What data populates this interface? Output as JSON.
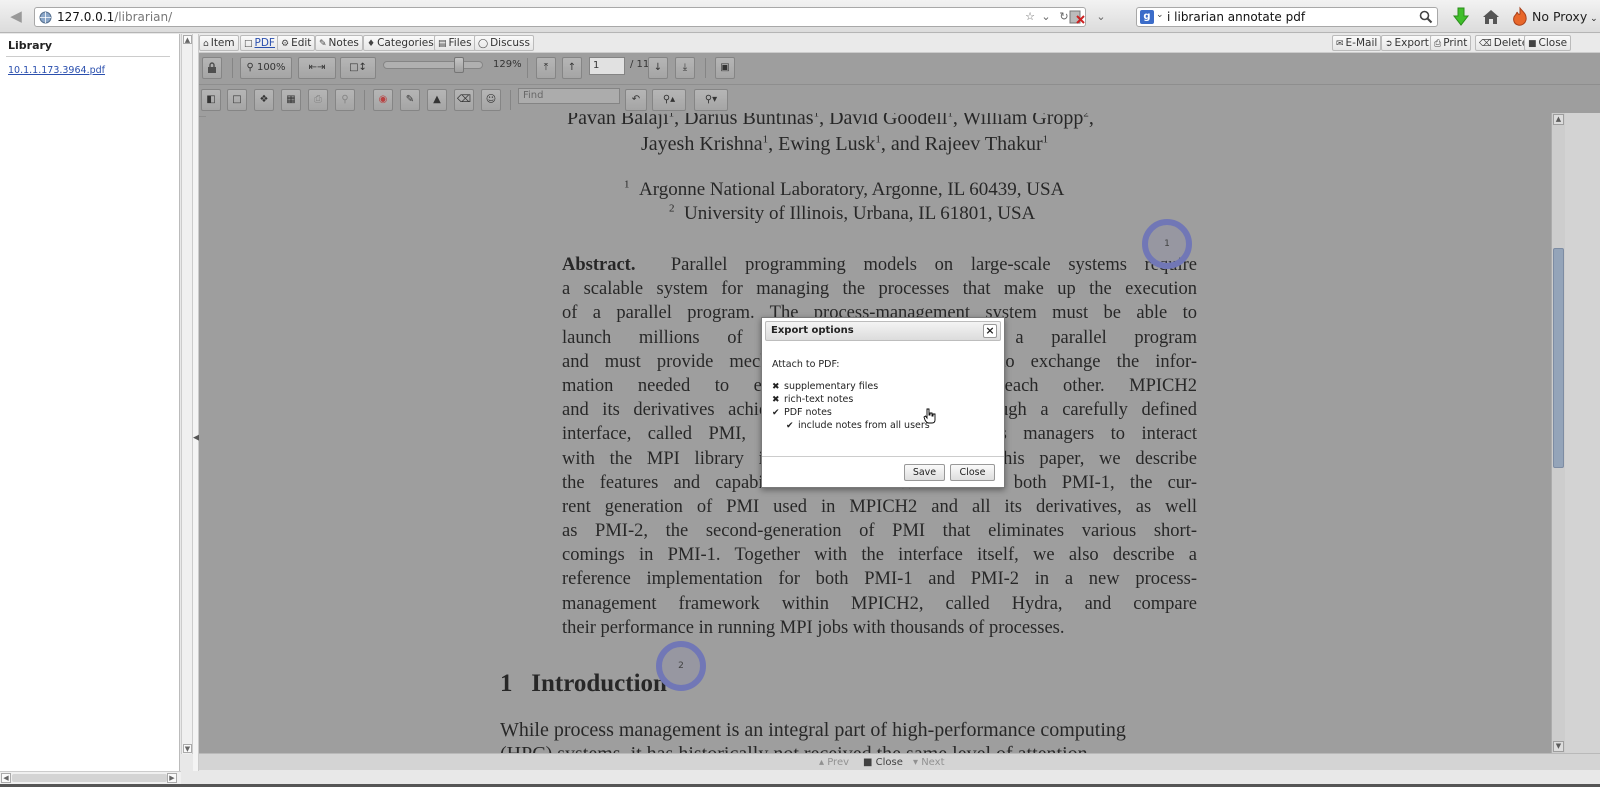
{
  "browser": {
    "url_host": "127.0.0.1",
    "url_path": "/librarian/",
    "search_query": "i librarian annotate pdf",
    "proxy_label": "No Proxy"
  },
  "sidebar": {
    "title": "Library",
    "files": [
      "10.1.1.173.3964.pdf"
    ]
  },
  "tabs_left": [
    {
      "label": "Item",
      "icon": "home-icon"
    },
    {
      "label": "PDF",
      "icon": "document-icon",
      "active": true
    },
    {
      "label": "Edit",
      "icon": "gear-icon"
    },
    {
      "label": "Notes",
      "icon": "pencil-icon"
    },
    {
      "label": "Categories",
      "icon": "tag-icon"
    },
    {
      "label": "Files",
      "icon": "files-icon"
    },
    {
      "label": "Discuss",
      "icon": "chat-icon"
    }
  ],
  "tabs_right": [
    {
      "label": "E-Mail",
      "icon": "mail-icon"
    },
    {
      "label": "Export",
      "icon": "export-icon"
    },
    {
      "label": "Print",
      "icon": "print-icon"
    },
    {
      "label": "Delete",
      "icon": "trash-icon"
    },
    {
      "label": "Close",
      "icon": "close-icon"
    }
  ],
  "viewer": {
    "zoom_button": "100%",
    "zoom_value": "129%",
    "current_page": "1",
    "total_pages": "/ 11",
    "find_placeholder": "Find",
    "slider_level": 0.8
  },
  "document": {
    "authors_line1": [
      "Pavan Balaji",
      "1",
      ", Darius Buntinas",
      "1",
      ", David Goodell",
      "1",
      ", William Gropp",
      "2",
      ","
    ],
    "authors_line2": [
      "Jayesh Krishna",
      "1",
      ", Ewing Lusk",
      "1",
      ", and Rajeev Thakur",
      "1"
    ],
    "affiliation1": {
      "sup": "1",
      "text": "Argonne National Laboratory, Argonne, IL 60439, USA"
    },
    "affiliation2": {
      "sup": "2",
      "text": "University of Illinois, Urbana, IL 61801, USA"
    },
    "abstract_label": "Abstract.",
    "abstract_lines": [
      "Parallel programming models on large-scale systems require",
      "a scalable system for managing the processes that make up the execution",
      "of a parallel program. The process-management system must be able to",
      "launch millions of processes and initialize a parallel program",
      "and must provide mechanisms for the processes to exchange the infor-",
      "mation needed to enable them to contact each other. MPICH2",
      "and its derivatives achieve these functionalities through a carefully defined",
      "interface, called PMI, that allows different process managers to interact",
      "with the MPI library in a standardized way. In this paper, we describe",
      "the features and capabilities of PMI. We describe both PMI-1, the cur-",
      "rent generation of PMI used in MPICH2 and all its derivatives, as well",
      "as PMI-2, the second-generation of PMI that eliminates various short-",
      "comings in PMI-1. Together with the interface itself, we also describe a",
      "reference implementation for both PMI-1 and PMI-2 in a new process-",
      "management framework within MPICH2, called Hydra, and compare",
      "their performance in running MPI jobs with thousands of processes."
    ],
    "section_number": "1",
    "section_title": "Introduction",
    "intro_line": "While process management is an integral part of high-performance computing",
    "intro_line2": "(HPC) systems, it has historically not received the same level of attention"
  },
  "annotations": [
    {
      "label": "1"
    },
    {
      "label": "2"
    }
  ],
  "bottom_bar": {
    "prev": "Prev",
    "close": "Close",
    "next": "Next"
  },
  "export_dialog": {
    "title": "Export options",
    "attach_label": "Attach to PDF:",
    "options": [
      {
        "label": "supplementary files",
        "checked": false
      },
      {
        "label": "rich-text notes",
        "checked": false
      },
      {
        "label": "PDF notes",
        "checked": true
      },
      {
        "label": "include notes from all users",
        "checked": true
      }
    ],
    "save_label": "Save",
    "close_label": "Close"
  },
  "colors": {
    "annotation_ring": "#7078c8",
    "link": "#2a4fae",
    "viewer_bg": "#a9a9a9"
  }
}
